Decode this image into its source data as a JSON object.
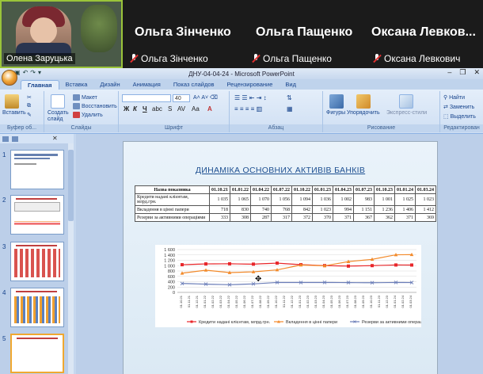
{
  "video": {
    "tiles": [
      {
        "label": "Олена Заруцька"
      },
      {
        "big_name": "Ольга Зінченко",
        "mic_label": "Ольга Зінченко"
      },
      {
        "big_name": "Ольга Пащенко",
        "mic_label": "Ольга Пащенко"
      },
      {
        "big_name": "Оксана  Левков...",
        "mic_label": "Оксана Левкович"
      }
    ]
  },
  "window": {
    "title": "ДНУ-04-04-24 - Microsoft PowerPoint",
    "controls": [
      "–",
      "❐",
      "✕"
    ]
  },
  "ribbon": {
    "tabs": [
      "Главная",
      "Вставка",
      "Дизайн",
      "Анимация",
      "Показ слайдов",
      "Рецензирование",
      "Вид"
    ],
    "active_tab": "Главная",
    "clipboard": {
      "paste": "Вставить",
      "label": "Буфер об..."
    },
    "slides": {
      "create": "Создать слайд",
      "layout": "Макет",
      "restore": "Восстановить",
      "delete": "Удалить",
      "label": "Слайды"
    },
    "font": {
      "size": "40",
      "label": "Шрифт"
    },
    "paragraph": {
      "label": "Абзац"
    },
    "drawing": {
      "shapes": "Фигуры",
      "arrange": "Упорядочить",
      "quick_styles": "Экспресс-стили",
      "label": "Рисование"
    },
    "editing": {
      "find": "Найти",
      "replace": "Заменить",
      "select": "Выделить",
      "label": "Редактирован"
    }
  },
  "thumbnails": [
    "1",
    "2",
    "3",
    "4",
    "5"
  ],
  "slide": {
    "title": "ДИНАМІКА ОСНОВНИХ АКТИВІВ БАНКІВ",
    "table": {
      "header": [
        "Назва показника",
        "01.10.21",
        "01.01.22",
        "01.04.22",
        "01.07.22",
        "01.10.22",
        "01.01.23",
        "01.04.23",
        "01.07.23",
        "01.10.23",
        "01.01.24",
        "01.03.24"
      ],
      "rows": [
        [
          "Кредити надані клієнтам, млрд.грн.",
          "1 035",
          "1 065",
          "1 070",
          "1 056",
          "1 094",
          "1 036",
          "1 002",
          "983",
          "1 001",
          "1 025",
          "1 023"
        ],
        [
          "Вкладення в цінні папери",
          "718",
          "830",
          "740",
          "768",
          "842",
          "1 023",
          "994",
          "1 151",
          "1 236",
          "1 406",
          "1 412"
        ],
        [
          "Резерви за активними операціями",
          "333",
          "308",
          "287",
          "317",
          "372",
          "370",
          "371",
          "367",
          "362",
          "371",
          "369"
        ]
      ]
    }
  },
  "chart_data": {
    "type": "line",
    "ylim": [
      0,
      1600
    ],
    "yticks": [
      "0",
      "200",
      "400",
      "600",
      "800",
      "1 000",
      "1 200",
      "1 400",
      "1 600"
    ],
    "x": [
      "01.10.21",
      "01.11.21",
      "01.12.21",
      "01.01.22",
      "01.02.22",
      "01.03.22",
      "01.04.22",
      "01.05.22",
      "01.06.22",
      "01.07.22",
      "01.08.22",
      "01.09.22",
      "01.10.22",
      "01.11.22",
      "01.12.22",
      "01.01.23",
      "01.02.23",
      "01.03.23",
      "01.04.23",
      "01.05.23",
      "01.06.23",
      "01.07.23",
      "01.08.23",
      "01.09.23",
      "01.10.23",
      "01.11.23",
      "01.12.23",
      "01.01.24",
      "01.02.24",
      "01.03.24"
    ],
    "series": [
      {
        "name": "Кредити надані клієнтам, млрд.грн.",
        "color": "#e8262a",
        "marker": "square",
        "values": [
          1035,
          1045,
          1055,
          1065,
          1067,
          1069,
          1070,
          1065,
          1060,
          1056,
          1070,
          1082,
          1094,
          1075,
          1055,
          1036,
          1025,
          1013,
          1002,
          995,
          989,
          983,
          989,
          995,
          1001,
          1009,
          1017,
          1025,
          1024,
          1023
        ]
      },
      {
        "name": "Вкладення в цінні папери",
        "color": "#f28a2b",
        "marker": "triangle",
        "values": [
          718,
          755,
          793,
          830,
          800,
          770,
          740,
          749,
          759,
          768,
          793,
          817,
          842,
          902,
          963,
          1023,
          1013,
          1004,
          994,
          1046,
          1099,
          1151,
          1179,
          1208,
          1236,
          1293,
          1349,
          1406,
          1409,
          1412
        ]
      },
      {
        "name": "Резерви за активними операціями",
        "color": "#6a7db8",
        "marker": "x",
        "values": [
          333,
          325,
          316,
          308,
          301,
          294,
          287,
          297,
          307,
          317,
          335,
          354,
          372,
          371,
          371,
          370,
          370,
          371,
          371,
          370,
          368,
          367,
          365,
          364,
          362,
          365,
          368,
          371,
          370,
          369
        ]
      }
    ]
  }
}
